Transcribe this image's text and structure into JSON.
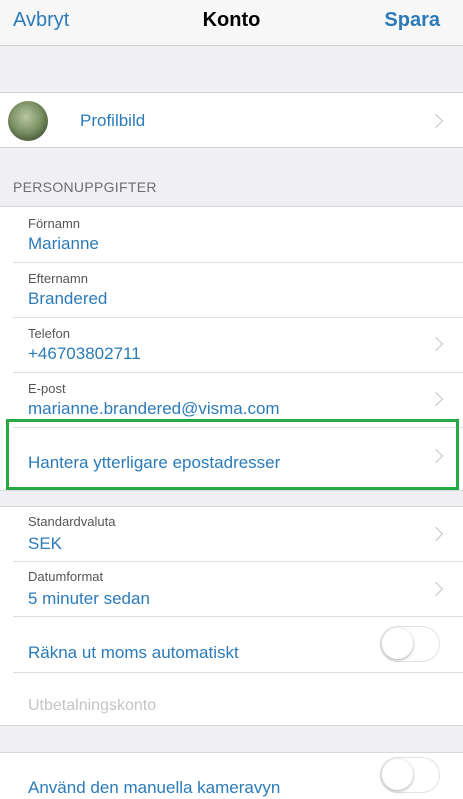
{
  "nav": {
    "cancel": "Avbryt",
    "title": "Konto",
    "save": "Spara"
  },
  "profile": {
    "label": "Profilbild"
  },
  "personal": {
    "header": "PERSONUPPGIFTER",
    "first_name": {
      "label": "Förnamn",
      "value": "Marianne"
    },
    "last_name": {
      "label": "Efternamn",
      "value": "Brandered"
    },
    "phone": {
      "label": "Telefon",
      "value": "+46703802711"
    },
    "email": {
      "label": "E-post",
      "value": "marianne.brandered@visma.com"
    },
    "manage_emails": "Hantera ytterligare epostadresser"
  },
  "settings": {
    "currency": {
      "label": "Standardvaluta",
      "value": "SEK"
    },
    "date_format": {
      "label": "Datumformat",
      "value": "5 minuter sedan"
    },
    "auto_vat": {
      "label": "Räkna ut moms automatiskt",
      "on": false
    },
    "payout_account": "Utbetalningskonto"
  },
  "camera": {
    "label": "Använd den manuella kameravyn",
    "on": false
  },
  "colors": {
    "accent": "#2b7bb9",
    "highlight": "#27a844"
  }
}
